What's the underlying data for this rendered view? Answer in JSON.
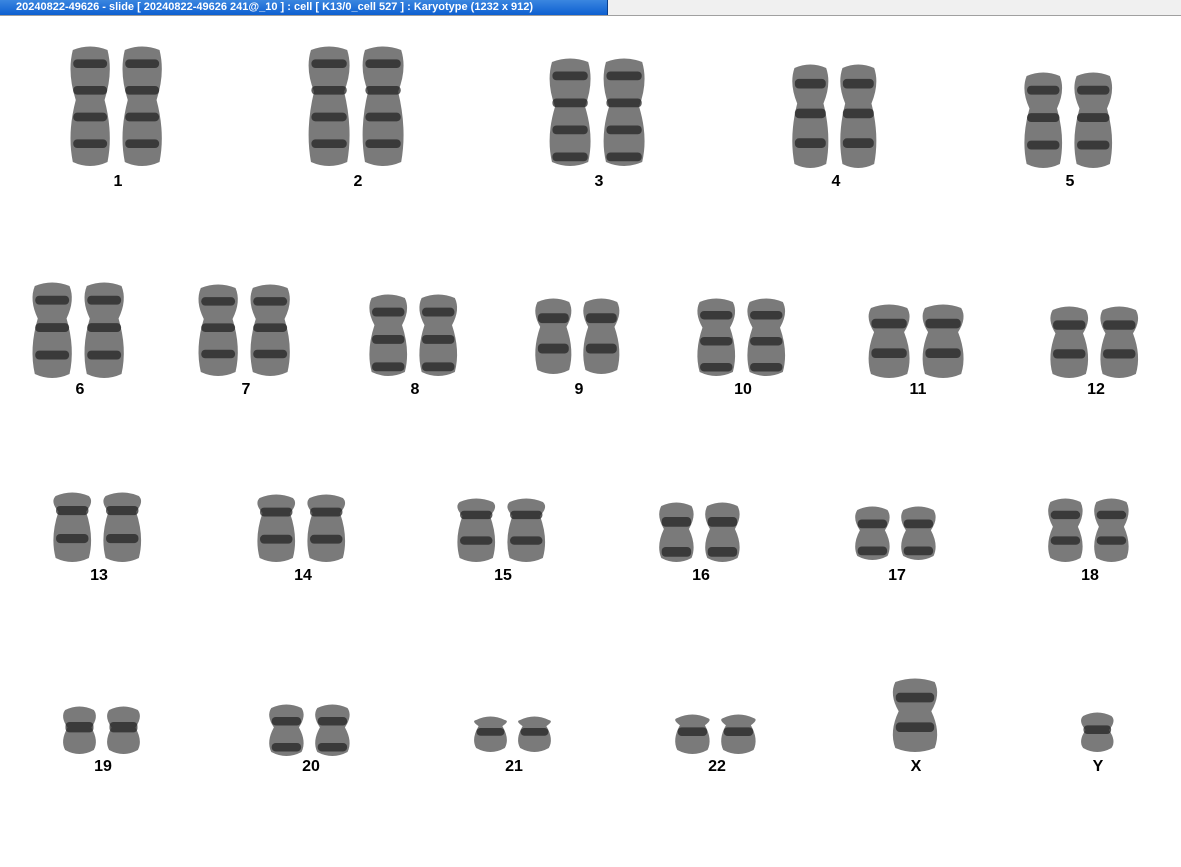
{
  "window": {
    "title": "20240822-49626 - slide [ 20240822-49626 241@_10 ] : cell [ K13/0_cell 527 ] : Karyotype  (1232 x 912)"
  },
  "karyotype": {
    "chromosomes": [
      {
        "label": "1",
        "copies": 2
      },
      {
        "label": "2",
        "copies": 2
      },
      {
        "label": "3",
        "copies": 2
      },
      {
        "label": "4",
        "copies": 2
      },
      {
        "label": "5",
        "copies": 2
      },
      {
        "label": "6",
        "copies": 2
      },
      {
        "label": "7",
        "copies": 2
      },
      {
        "label": "8",
        "copies": 2
      },
      {
        "label": "9",
        "copies": 2
      },
      {
        "label": "10",
        "copies": 2
      },
      {
        "label": "11",
        "copies": 2
      },
      {
        "label": "12",
        "copies": 2
      },
      {
        "label": "13",
        "copies": 2
      },
      {
        "label": "14",
        "copies": 2
      },
      {
        "label": "15",
        "copies": 2
      },
      {
        "label": "16",
        "copies": 2
      },
      {
        "label": "17",
        "copies": 2
      },
      {
        "label": "18",
        "copies": 2
      },
      {
        "label": "19",
        "copies": 2
      },
      {
        "label": "20",
        "copies": 2
      },
      {
        "label": "21",
        "copies": 2
      },
      {
        "label": "22",
        "copies": 2
      },
      {
        "label": "X",
        "copies": 1
      },
      {
        "label": "Y",
        "copies": 1
      }
    ]
  },
  "colors": {
    "title_bar": "#0d5fd0",
    "title_text": "#ffffff",
    "background": "#ffffff",
    "label_text": "#000000"
  }
}
